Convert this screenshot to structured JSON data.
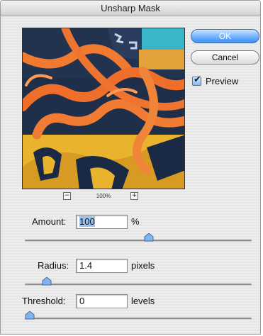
{
  "window": {
    "title": "Unsharp Mask"
  },
  "buttons": {
    "ok": "OK",
    "cancel": "Cancel"
  },
  "preview": {
    "label": "Preview",
    "checked": true
  },
  "zoom": {
    "out_symbol": "−",
    "level": "100%",
    "in_symbol": "+"
  },
  "amount": {
    "label": "Amount:",
    "value": "100",
    "unit": "%",
    "slider_fraction": 0.55
  },
  "radius": {
    "label": "Radius:",
    "value": "1.4",
    "unit": "pixels",
    "slider_fraction": 0.08
  },
  "threshold": {
    "label": "Threshold:",
    "value": "0",
    "unit": "levels",
    "slider_fraction": 0.0
  },
  "colors": {
    "default_button": "#4a9af5",
    "selection": "#9cc2ef",
    "thumb": "#7fb4ef"
  }
}
